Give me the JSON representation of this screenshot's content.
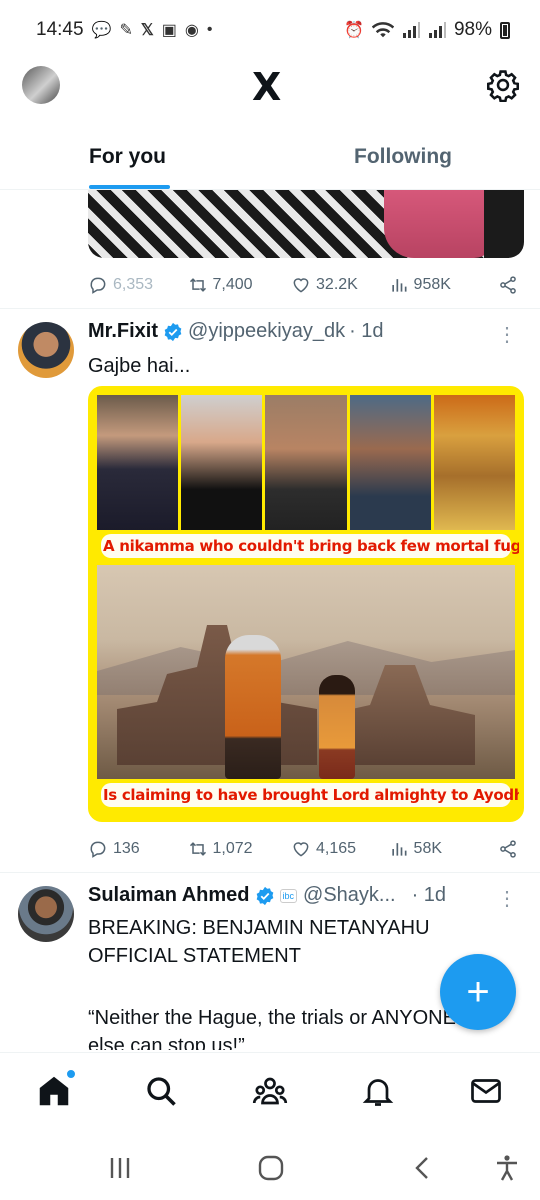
{
  "status_bar": {
    "time": "14:45",
    "notification_icons": [
      "chat-bubble-icon",
      "app-icon",
      "x-app-icon",
      "gallery-icon",
      "account-icon"
    ],
    "dot": "•",
    "battery": "98%",
    "network": [
      "alarm-icon",
      "wifi-icon",
      "signal-icon",
      "signal-icon"
    ]
  },
  "header": {
    "logo": "X"
  },
  "tabs": [
    {
      "label": "For you",
      "active": true
    },
    {
      "label": "Following",
      "active": false
    }
  ],
  "tweets": [
    {
      "partial": true,
      "stats": {
        "replies": "6,353",
        "reposts": "7,400",
        "likes": "32.2K",
        "views": "958K"
      }
    },
    {
      "name": "Mr.Fixit",
      "verified": true,
      "handle": "@yippeekiyay_dk",
      "time": "· 1d",
      "text": "Gajbe hai...",
      "image": {
        "caption_top": "A nikamma who couldn't bring back few mortal fugitives",
        "caption_bottom": "Is claiming to have brought Lord almighty to Ayodhya"
      },
      "stats": {
        "replies": "136",
        "reposts": "1,072",
        "likes": "4,165",
        "views": "58K"
      }
    },
    {
      "name": "Sulaiman Ahmed",
      "verified": true,
      "affiliate_badge": "ibc",
      "handle": "@Shayk...",
      "time": "· 1d",
      "text_lines": [
        "BREAKING: BENJAMIN NETANYAHU",
        "OFFICIAL STATEMENT",
        "",
        "“Neither the Hague, the trials or ANYONE",
        "else can stop us!”"
      ]
    }
  ],
  "fab": {
    "label": "+"
  },
  "colors": {
    "accent": "#1d9bf0",
    "text_primary": "#0f1419",
    "text_secondary": "#536471",
    "image_border": "#ffea00",
    "caption_red": "#e21a00"
  }
}
